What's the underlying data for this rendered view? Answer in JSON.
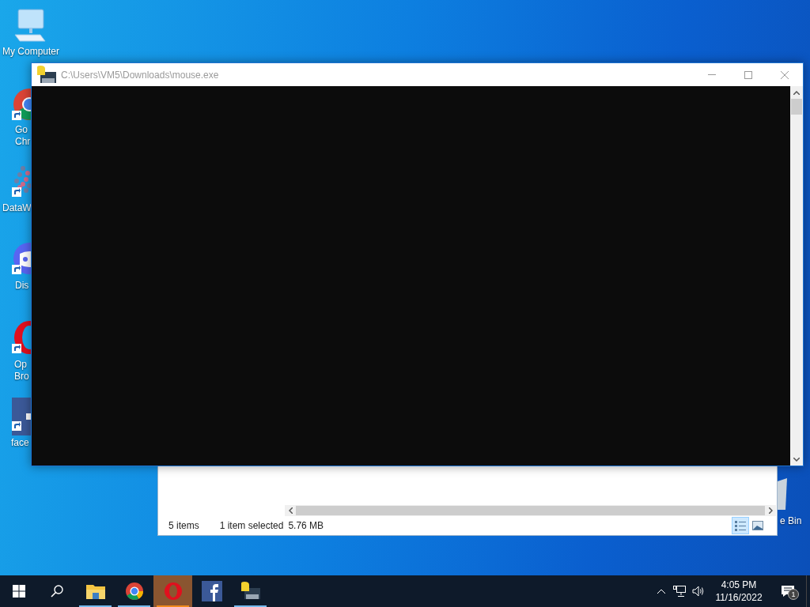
{
  "desktop_icons": [
    {
      "kind": "computer",
      "lines": [
        "My Computer"
      ]
    },
    {
      "kind": "chrome",
      "lines": [
        "Go",
        "Chr"
      ]
    },
    {
      "kind": "dots",
      "lines": [
        "DataW"
      ]
    },
    {
      "kind": "discord",
      "lines": [
        "Dis"
      ]
    },
    {
      "kind": "opera",
      "lines": [
        "Op",
        "Bro"
      ]
    },
    {
      "kind": "facebook",
      "lines": [
        "face"
      ]
    },
    {
      "kind": "bin",
      "lines": [
        "e Bin"
      ]
    }
  ],
  "console_window": {
    "title": "C:\\Users\\VM5\\Downloads\\mouse.exe"
  },
  "explorer_window": {
    "item_count": "5 items",
    "selection": "1 item selected",
    "size": "5.76 MB",
    "views": [
      {
        "kind": "details",
        "selected": true
      },
      {
        "kind": "large",
        "selected": false
      }
    ]
  },
  "taskbar": {
    "apps": [
      {
        "kind": "folder",
        "selected": false,
        "running": true
      },
      {
        "kind": "chrome",
        "selected": false,
        "running": true
      },
      {
        "kind": "opera",
        "selected": true,
        "running": true
      },
      {
        "kind": "facebook",
        "selected": false,
        "running": false
      },
      {
        "kind": "console",
        "selected": false,
        "running": true
      }
    ],
    "time": "4:05 PM",
    "date": "11/16/2022",
    "notification_count": "1"
  }
}
